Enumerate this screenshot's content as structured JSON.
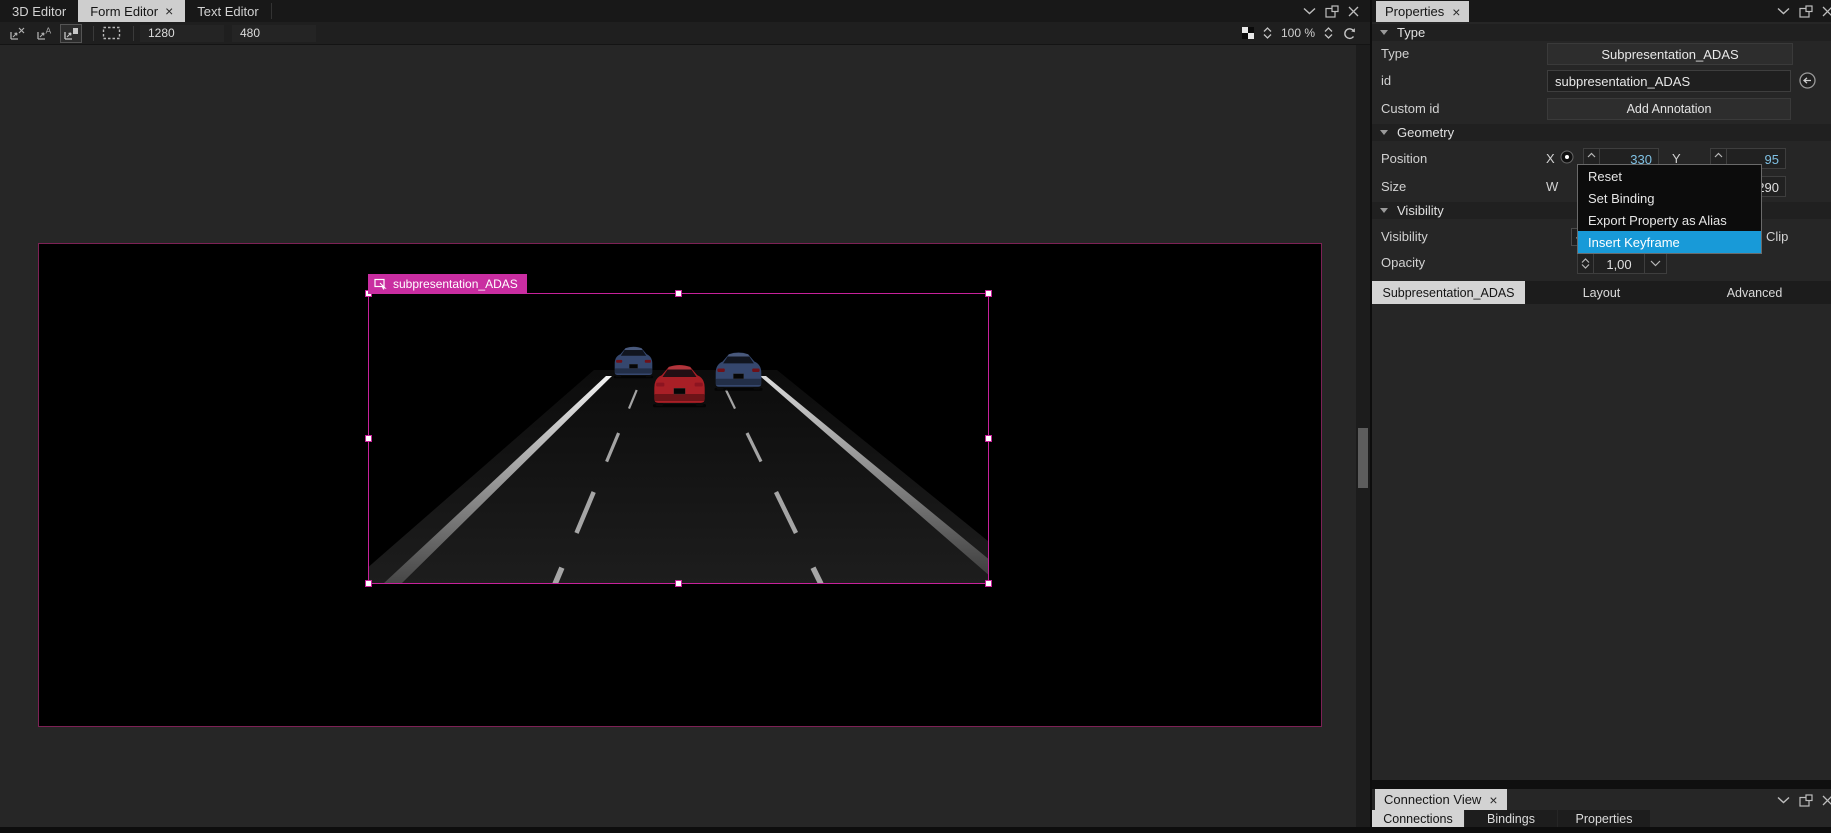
{
  "colors": {
    "accent_pink": "#c7219b",
    "label_pink": "#c92da1",
    "canvas_border": "#7d2155",
    "menu_highlight": "#189ad8",
    "value_blue": "#7fc1e4",
    "red_car": "#a81f26",
    "blue_car": "#35476e",
    "road_gray": "#1a1a1a"
  },
  "editor_pane": {
    "tabs": [
      {
        "label": "3D Editor",
        "active": false
      },
      {
        "label": "Form Editor",
        "active": true,
        "closable": true
      },
      {
        "label": "Text Editor",
        "active": false
      }
    ],
    "toolbar": {
      "canvas_width": "1280",
      "canvas_height": "480",
      "zoom_level": "100 %"
    },
    "selection_label": "subpresentation_ADAS"
  },
  "properties_panel": {
    "title": "Properties",
    "type_section": {
      "header": "Type",
      "type_label": "Type",
      "type_value": "Subpresentation_ADAS",
      "id_label": "id",
      "id_value": "subpresentation_ADAS",
      "custom_id_label": "Custom id",
      "add_annotation_button": "Add Annotation"
    },
    "geometry_section": {
      "header": "Geometry",
      "position_label": "Position",
      "x_label": "X",
      "x_value": "330",
      "y_label": "Y",
      "y_value": "95",
      "size_label": "Size",
      "w_label": "W",
      "h_value": "290"
    },
    "visibility_section": {
      "header": "Visibility",
      "visibility_label": "Visibility",
      "visibility_checked": "✓",
      "clip_label": "Clip",
      "opacity_label": "Opacity",
      "opacity_value": "1,00"
    },
    "tabs": [
      {
        "label": "Subpresentation_ADAS",
        "active": true
      },
      {
        "label": "Layout",
        "active": false
      },
      {
        "label": "Advanced",
        "active": false
      }
    ]
  },
  "context_menu": {
    "items": [
      "Reset",
      "Set Binding",
      "Export Property as Alias",
      "Insert Keyframe"
    ],
    "highlighted_item": "Insert Keyframe"
  },
  "connection_view": {
    "title": "Connection View",
    "tabs": [
      {
        "label": "Connections",
        "active": true
      },
      {
        "label": "Bindings",
        "active": false
      },
      {
        "label": "Properties",
        "active": false
      }
    ]
  }
}
